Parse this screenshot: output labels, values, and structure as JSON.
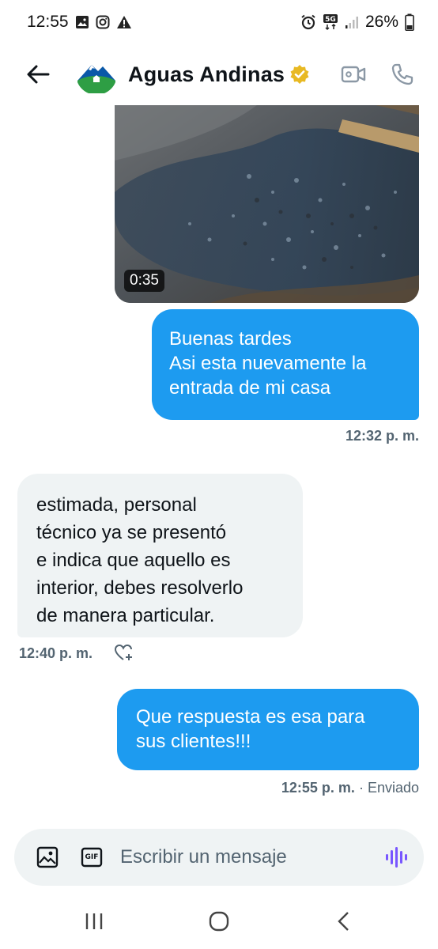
{
  "status_bar": {
    "time": "12:55",
    "battery": "26%",
    "icons": [
      "gallery-icon",
      "instagram-icon",
      "warning-icon",
      "alarm-icon",
      "5g-icon",
      "signal-icon",
      "battery-icon"
    ]
  },
  "header": {
    "title": "Aguas Andinas",
    "verified": true,
    "icons": [
      "back-arrow-icon",
      "verified-badge-icon",
      "video-call-icon",
      "phone-icon"
    ]
  },
  "colors": {
    "sent_bubble": "#1d9bf0",
    "received_bubble": "#eff3f4",
    "meta_text": "#536471",
    "verified_gold": "#e8b923",
    "mic_purple": "#7856ff"
  },
  "messages": [
    {
      "type": "video",
      "direction": "sent",
      "duration": "0:35"
    },
    {
      "type": "text",
      "direction": "sent",
      "lines": [
        "Buenas tardes",
        "Asi esta nuevamente la",
        "entrada de mi casa"
      ],
      "time": "12:32 p. m."
    },
    {
      "type": "text",
      "direction": "received",
      "lines": [
        "estimada, personal",
        "técnico ya se presentó",
        "e indica que aquello es",
        "interior, debes resolverlo",
        "de manera particular."
      ],
      "time": "12:40 p. m."
    },
    {
      "type": "text",
      "direction": "sent",
      "lines": [
        "Que respuesta es esa para",
        "sus clientes!!!"
      ],
      "time": "12:55 p. m.",
      "status": "· Enviado"
    }
  ],
  "composer": {
    "placeholder": "Escribir un mensaje",
    "gif_label": "GIF"
  },
  "nav_bar": {
    "icons": [
      "recents-icon",
      "home-icon",
      "back-icon"
    ]
  }
}
